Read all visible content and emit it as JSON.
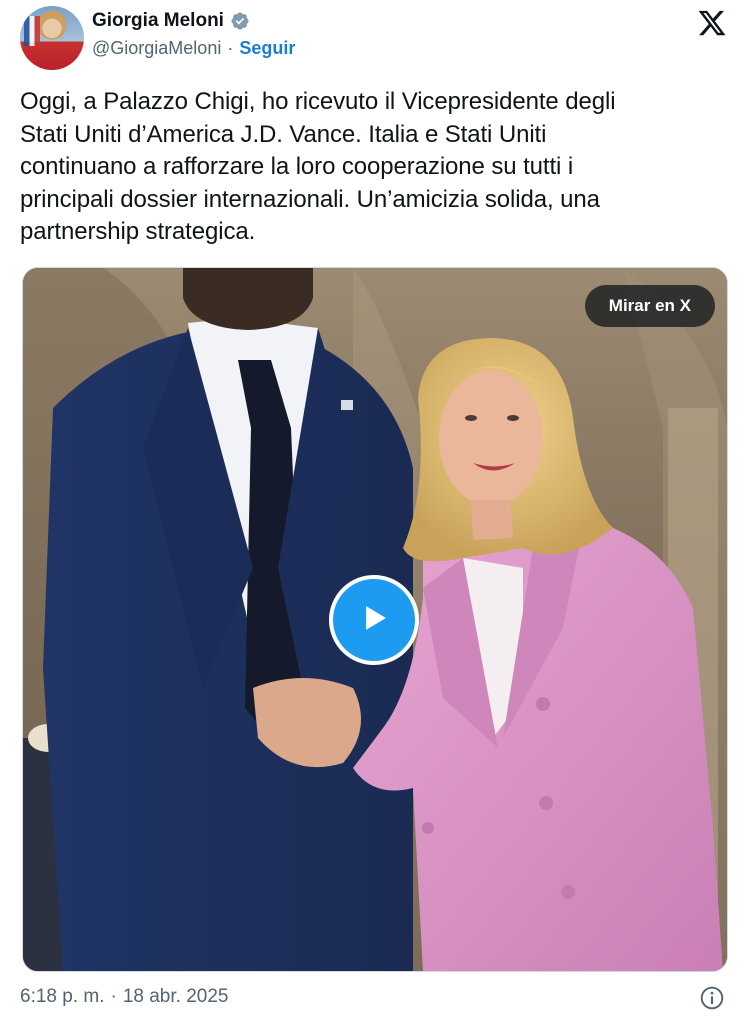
{
  "author": {
    "display_name": "Giorgia Meloni",
    "handle": "@GiorgiaMeloni",
    "separator": "·",
    "follow_label": "Seguir",
    "verified": true
  },
  "tweet": {
    "lines": [
      "Oggi, a Palazzo Chigi, ho ricevuto il Vicepresidente degli",
      "Stati Uniti d’America J.D. Vance. Italia e Stati Uniti",
      "continuano a rafforzare la loro cooperazione su tutti i",
      "principali dossier internazionali. Un’amicizia solida, una",
      "partnership strategica."
    ]
  },
  "media": {
    "watch_label": "Mirar en X",
    "type": "video"
  },
  "footer": {
    "time": "6:18 p. m.",
    "separator": "·",
    "date": "18 abr. 2025"
  },
  "icons": {
    "verified": "verified-badge-icon",
    "brand": "x-logo-icon",
    "play": "play-icon",
    "info": "info-icon"
  },
  "colors": {
    "link": "#1d7bd8",
    "secondary_text": "#536471",
    "play_button": "#1d9bf0",
    "suit_navy": "#1f2f5a",
    "blazer_pink": "#d98bc0"
  }
}
